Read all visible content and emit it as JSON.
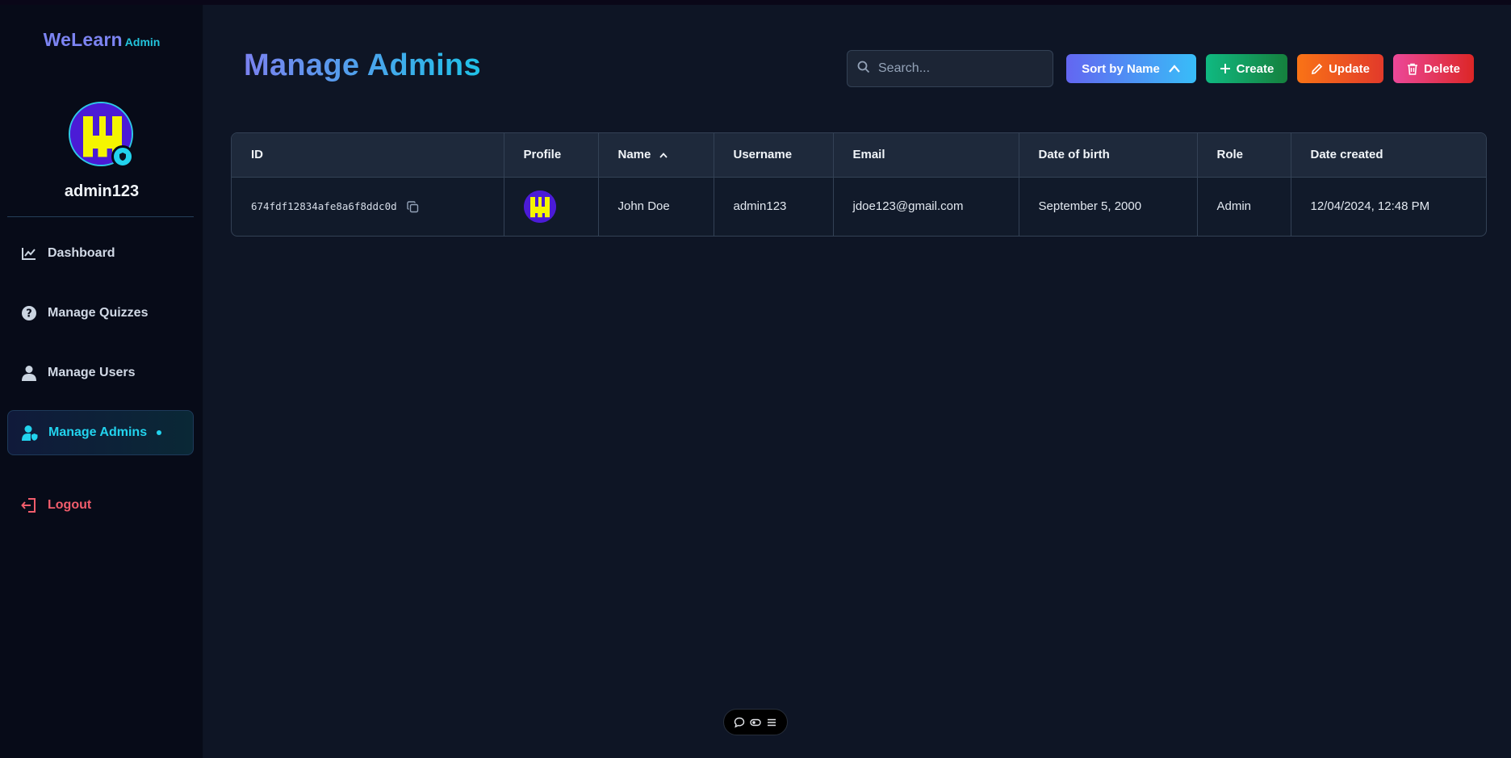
{
  "brand": {
    "name": "WeLearn",
    "tag": "Admin"
  },
  "user": {
    "username": "admin123"
  },
  "sidebar": {
    "items": [
      {
        "label": "Dashboard",
        "icon": "chart-line-icon"
      },
      {
        "label": "Manage Quizzes",
        "icon": "question-circle-icon"
      },
      {
        "label": "Manage Users",
        "icon": "user-icon"
      },
      {
        "label": "Manage Admins",
        "icon": "user-shield-icon",
        "active": true
      }
    ],
    "logout": {
      "label": "Logout",
      "icon": "logout-icon"
    }
  },
  "page": {
    "title": "Manage Admins"
  },
  "toolbar": {
    "search_placeholder": "Search...",
    "sort_label": "Sort by Name",
    "create_label": "Create",
    "update_label": "Update",
    "delete_label": "Delete"
  },
  "table": {
    "columns": [
      "ID",
      "Profile",
      "Name",
      "Username",
      "Email",
      "Date of birth",
      "Role",
      "Date created"
    ],
    "rows": [
      {
        "id": "674fdf12834afe8a6f8ddc0d",
        "name": "John Doe",
        "username": "admin123",
        "email": "jdoe123@gmail.com",
        "dob": "September 5, 2000",
        "role": "Admin",
        "created": "12/04/2024, 12:48 PM"
      }
    ]
  },
  "colors": {
    "accent": "#22d3ee",
    "brand": "#7c84f2",
    "logout": "#f25d6c",
    "create": "#10b981",
    "update": "#f97316",
    "delete": "#ec4899"
  }
}
